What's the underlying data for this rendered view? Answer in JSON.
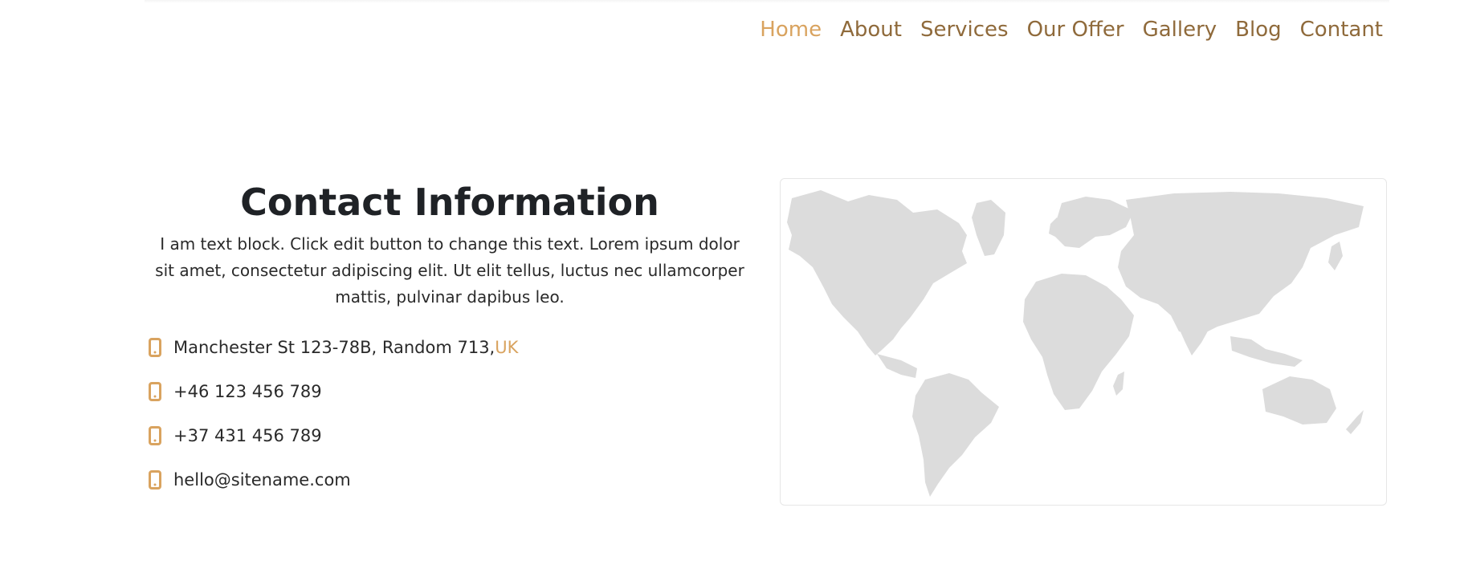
{
  "nav": {
    "items": [
      {
        "label": "Home",
        "active": true
      },
      {
        "label": "About",
        "active": false
      },
      {
        "label": "Services",
        "active": false
      },
      {
        "label": "Our Offer",
        "active": false
      },
      {
        "label": "Gallery",
        "active": false
      },
      {
        "label": "Blog",
        "active": false
      },
      {
        "label": "Contant",
        "active": false
      }
    ]
  },
  "contact": {
    "title": "Contact Information",
    "description": "I am text block. Click edit button to change this text. Lorem ipsum dolor sit amet, consectetur adipiscing elit. Ut elit tellus, luctus nec ullamcorper mattis, pulvinar dapibus leo.",
    "address": "Manchester St 123-78B, Random 713,",
    "address_highlight": "UK",
    "phone_1": "+46 123 456 789",
    "phone_2": "+37 431 456 789",
    "email": "hello@sitename.com",
    "icon": "phone-icon"
  },
  "map": {
    "icon": "world-map"
  },
  "colors": {
    "accent": "#d9a35f",
    "nav_text": "#8f6a3b",
    "heading": "#1f2226",
    "map_land": "#dcdcdc"
  }
}
